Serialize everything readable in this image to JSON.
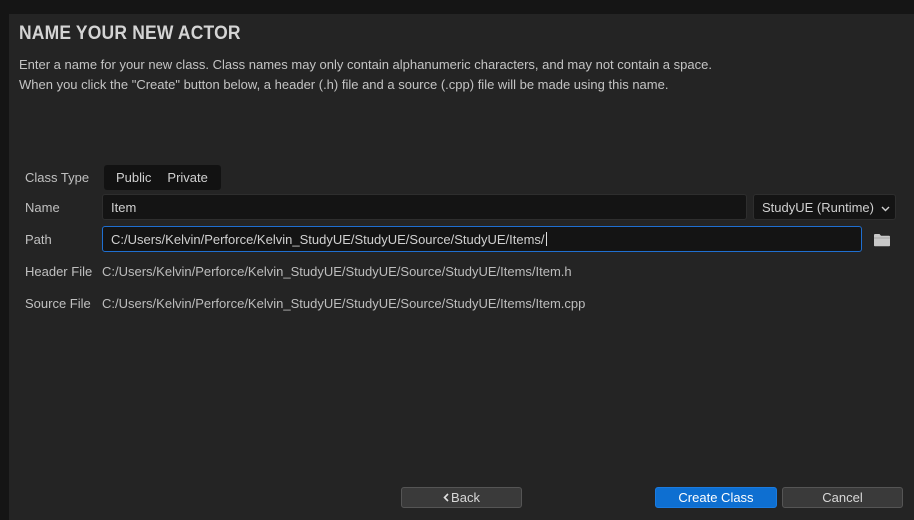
{
  "dialog": {
    "title": "NAME YOUR NEW ACTOR",
    "description_line1": "Enter a name for your new class. Class names may only contain alphanumeric characters, and may not contain a space.",
    "description_line2": "When you click the \"Create\" button below, a header (.h) file and a source (.cpp) file will be made using this name."
  },
  "form": {
    "class_type": {
      "label": "Class Type",
      "options": [
        "Public",
        "Private"
      ]
    },
    "name": {
      "label": "Name",
      "value": "Item"
    },
    "module": {
      "selected": "StudyUE (Runtime)"
    },
    "path": {
      "label": "Path",
      "value": "C:/Users/Kelvin/Perforce/Kelvin_StudyUE/StudyUE/Source/StudyUE/Items/"
    },
    "header_file": {
      "label": "Header File",
      "value": "C:/Users/Kelvin/Perforce/Kelvin_StudyUE/StudyUE/Source/StudyUE/Items/Item.h"
    },
    "source_file": {
      "label": "Source File",
      "value": "C:/Users/Kelvin/Perforce/Kelvin_StudyUE/StudyUE/Source/StudyUE/Items/Item.cpp"
    }
  },
  "buttons": {
    "back": "Back",
    "create": "Create Class",
    "cancel": "Cancel"
  },
  "icons": {
    "folder": "folder-icon",
    "dropdown": "chevron-down-icon",
    "back": "chevron-left-icon"
  },
  "colors": {
    "accent": "#0e6fd1",
    "background": "#242424",
    "input_background": "#141414"
  }
}
